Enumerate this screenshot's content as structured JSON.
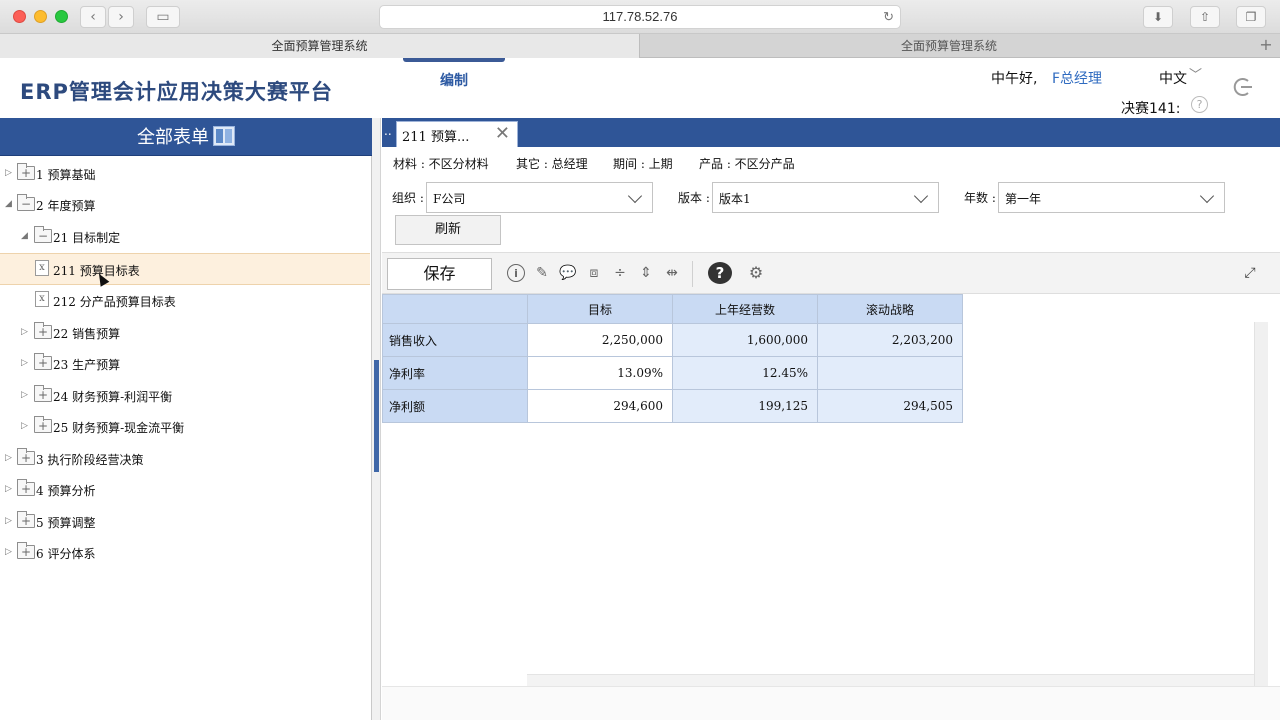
{
  "browser": {
    "url": "117.78.52.76",
    "tabs": [
      {
        "label": "全面预算管理系统"
      },
      {
        "label": "全面预算管理系统"
      }
    ],
    "new_tab": "+"
  },
  "header": {
    "brand": "ERP管理会计应用决策大赛平台",
    "nav_tab": "编制",
    "greeting": "中午好,",
    "user": "F总经理",
    "language": "中文",
    "contest": "决赛141:"
  },
  "sidebar": {
    "title": "全部表单",
    "nodes": [
      {
        "label": "1 预算基础",
        "expander": "▷",
        "folder_sign": "+"
      },
      {
        "label": "2 年度预算",
        "expander": "◢",
        "folder_sign": "−"
      },
      {
        "label": "21 目标制定",
        "expander": "◢",
        "folder_sign": "−"
      },
      {
        "label": "211 预算目标表",
        "expander": "",
        "folder_sign": ""
      },
      {
        "label": "212 分产品预算目标表",
        "expander": "",
        "folder_sign": ""
      },
      {
        "label": "22 销售预算",
        "expander": "▷",
        "folder_sign": "+"
      },
      {
        "label": "23 生产预算",
        "expander": "▷",
        "folder_sign": "+"
      },
      {
        "label": "24 财务预算-利润平衡",
        "expander": "▷",
        "folder_sign": "+"
      },
      {
        "label": "25 财务预算-现金流平衡",
        "expander": "▷",
        "folder_sign": "+"
      },
      {
        "label": "3 执行阶段经营决策",
        "expander": "▷",
        "folder_sign": "+"
      },
      {
        "label": "4 预算分析",
        "expander": "▷",
        "folder_sign": "+"
      },
      {
        "label": "5 预算调整",
        "expander": "▷",
        "folder_sign": "+"
      },
      {
        "label": "6 评分体系",
        "expander": "▷",
        "folder_sign": "+"
      }
    ]
  },
  "panel": {
    "tab_prefix": "..",
    "tab_label": "211 预算...",
    "tab_close": "✕",
    "info_line": {
      "material": "材料 : 不区分材料",
      "other": "其它 : 总经理",
      "period": "期间 : 上期",
      "product": "产品 : 不区分产品"
    },
    "filters": {
      "org_label": "组织 :",
      "org_value": "F公司",
      "version_label": "版本 :",
      "version_value": "版本1",
      "year_label": "年数 :",
      "year_value": "第一年"
    },
    "refresh": "刷新",
    "save": "保存",
    "toolbar_icons": [
      "info-icon",
      "pencil-icon",
      "comment-icon",
      "box-icon",
      "split-rows-icon",
      "insert-row-icon",
      "insert-column-icon",
      "help-icon",
      "settings-icon",
      "fullscreen-icon"
    ]
  },
  "table": {
    "columns": [
      "目标",
      "上年经营数",
      "滚动战略"
    ],
    "rows": [
      {
        "label": "销售收入",
        "values": [
          "2,250,000",
          "1,600,000",
          "2,203,200"
        ]
      },
      {
        "label": "净利率",
        "values": [
          "13.09%",
          "12.45%",
          ""
        ]
      },
      {
        "label": "净利额",
        "values": [
          "294,600",
          "199,125",
          "294,505"
        ]
      }
    ]
  }
}
